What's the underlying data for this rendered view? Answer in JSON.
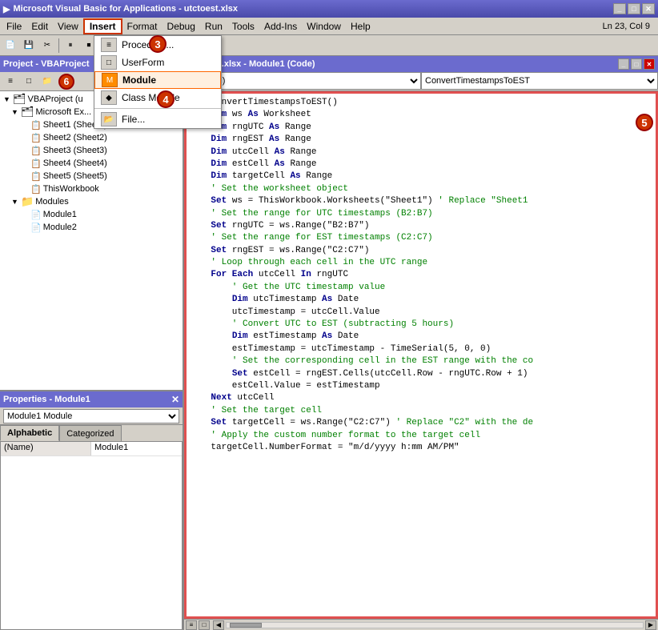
{
  "titlebar": {
    "title": "Microsoft Visual Basic for Applications - utctoest.xlsx",
    "icon": "▶"
  },
  "menubar": {
    "items": [
      {
        "label": "File",
        "id": "file"
      },
      {
        "label": "Edit",
        "id": "edit"
      },
      {
        "label": "View",
        "id": "view"
      },
      {
        "label": "Insert",
        "id": "insert",
        "active": true
      },
      {
        "label": "3",
        "id": "badge3",
        "badge": true
      },
      {
        "label": "Format",
        "id": "format"
      },
      {
        "label": "Debug",
        "id": "debug"
      },
      {
        "label": "Run",
        "id": "run"
      },
      {
        "label": "Tools",
        "id": "tools"
      },
      {
        "label": "Add-Ins",
        "id": "addins"
      },
      {
        "label": "Window",
        "id": "window"
      },
      {
        "label": "Help",
        "id": "help"
      }
    ]
  },
  "toolbar": {
    "status": "Ln 23, Col 9"
  },
  "dropdown": {
    "items": [
      {
        "label": "Procedure...",
        "id": "procedure",
        "icon": "≡"
      },
      {
        "label": "UserForm",
        "id": "userform",
        "icon": "□"
      },
      {
        "label": "Module",
        "id": "module",
        "icon": "📄",
        "highlighted": true
      },
      {
        "label": "Class Module",
        "id": "classmodule",
        "icon": "◆"
      },
      {
        "label": "File...",
        "id": "file",
        "icon": "📂"
      }
    ]
  },
  "project_panel": {
    "title": "Project - VBAProject",
    "tree": [
      {
        "label": "VBAProject (u",
        "level": 0,
        "expanded": true,
        "icon": "📁"
      },
      {
        "label": "Microsoft Ex...",
        "level": 1,
        "expanded": true,
        "icon": "📁"
      },
      {
        "label": "Sheet1 (Sheet1)",
        "level": 2,
        "expanded": false,
        "icon": "📄"
      },
      {
        "label": "Sheet2 (Sheet2)",
        "level": 2,
        "expanded": false,
        "icon": "📄"
      },
      {
        "label": "Sheet3 (Sheet3)",
        "level": 2,
        "expanded": false,
        "icon": "📄"
      },
      {
        "label": "Sheet4 (Sheet4)",
        "level": 2,
        "expanded": false,
        "icon": "📄"
      },
      {
        "label": "Sheet5 (Sheet5)",
        "level": 2,
        "expanded": false,
        "icon": "📄"
      },
      {
        "label": "ThisWorkbook",
        "level": 2,
        "expanded": false,
        "icon": "📄"
      },
      {
        "label": "Modules",
        "level": 1,
        "expanded": true,
        "icon": "📁"
      },
      {
        "label": "Module1",
        "level": 2,
        "expanded": false,
        "icon": "📄"
      },
      {
        "label": "Module2",
        "level": 2,
        "expanded": false,
        "icon": "📄"
      }
    ]
  },
  "properties_panel": {
    "title": "Properties - Module1",
    "dropdown_value": "Module1  Module",
    "tabs": [
      "Alphabetic",
      "Categorized"
    ],
    "active_tab": "Alphabetic",
    "rows": [
      {
        "name": "(Name)",
        "value": "Module1"
      }
    ]
  },
  "code_window": {
    "title": "utctoest.xlsx - Module1 (Code)",
    "selector_left": "(General)",
    "selector_right": "ConvertTimestampsToEST",
    "code_lines": [
      {
        "text": "Sub ConvertTimestampsToEST()",
        "tokens": [
          {
            "type": "kw",
            "text": "Sub"
          },
          {
            "type": "id",
            "text": " ConvertTimestampsToEST()"
          }
        ]
      },
      {
        "text": "    Dim ws As Worksheet",
        "tokens": [
          {
            "type": "id",
            "text": "    "
          },
          {
            "type": "kw",
            "text": "Dim"
          },
          {
            "type": "id",
            "text": " ws "
          },
          {
            "type": "kw",
            "text": "As"
          },
          {
            "type": "id",
            "text": " Worksheet"
          }
        ]
      },
      {
        "text": "    Dim rngUTC As Range",
        "tokens": [
          {
            "type": "id",
            "text": "    "
          },
          {
            "type": "kw",
            "text": "Dim"
          },
          {
            "type": "id",
            "text": " rngUTC "
          },
          {
            "type": "kw",
            "text": "As"
          },
          {
            "type": "id",
            "text": " Range"
          }
        ]
      },
      {
        "text": "    Dim rngEST As Range",
        "tokens": [
          {
            "type": "id",
            "text": "    "
          },
          {
            "type": "kw",
            "text": "Dim"
          },
          {
            "type": "id",
            "text": " rngEST "
          },
          {
            "type": "kw",
            "text": "As"
          },
          {
            "type": "id",
            "text": " Range"
          }
        ]
      },
      {
        "text": "    Dim utcCell As Range",
        "tokens": [
          {
            "type": "id",
            "text": "    "
          },
          {
            "type": "kw",
            "text": "Dim"
          },
          {
            "type": "id",
            "text": " utcCell "
          },
          {
            "type": "kw",
            "text": "As"
          },
          {
            "type": "id",
            "text": " Range"
          }
        ]
      },
      {
        "text": "    Dim estCell As Range",
        "tokens": [
          {
            "type": "id",
            "text": "    "
          },
          {
            "type": "kw",
            "text": "Dim"
          },
          {
            "type": "id",
            "text": " estCell "
          },
          {
            "type": "kw",
            "text": "As"
          },
          {
            "type": "id",
            "text": " Range"
          }
        ]
      },
      {
        "text": "    Dim targetCell As Range",
        "tokens": [
          {
            "type": "id",
            "text": "    "
          },
          {
            "type": "kw",
            "text": "Dim"
          },
          {
            "type": "id",
            "text": " targetCell "
          },
          {
            "type": "kw",
            "text": "As"
          },
          {
            "type": "id",
            "text": " Range"
          }
        ]
      },
      {
        "text": "",
        "tokens": []
      },
      {
        "text": "    ' Set the worksheet object",
        "tokens": [
          {
            "type": "cm",
            "text": "    ' Set the worksheet object"
          }
        ]
      },
      {
        "text": "    Set ws = ThisWorkbook.Worksheets(\"Sheet1\") ' Replace \"Sheet1",
        "tokens": [
          {
            "type": "id",
            "text": "    "
          },
          {
            "type": "kw",
            "text": "Set"
          },
          {
            "type": "id",
            "text": " ws = ThisWorkbook.Worksheets(\"Sheet1\")"
          },
          {
            "type": "cm",
            "text": " ' Replace \"Sheet1"
          }
        ]
      },
      {
        "text": "",
        "tokens": []
      },
      {
        "text": "    ' Set the range for UTC timestamps (B2:B7)",
        "tokens": [
          {
            "type": "cm",
            "text": "    ' Set the range for UTC timestamps (B2:B7)"
          }
        ]
      },
      {
        "text": "    Set rngUTC = ws.Range(\"B2:B7\")",
        "tokens": [
          {
            "type": "id",
            "text": "    "
          },
          {
            "type": "kw",
            "text": "Set"
          },
          {
            "type": "id",
            "text": " rngUTC = ws.Range(\"B2:B7\")"
          }
        ]
      },
      {
        "text": "",
        "tokens": []
      },
      {
        "text": "    ' Set the range for EST timestamps (C2:C7)",
        "tokens": [
          {
            "type": "cm",
            "text": "    ' Set the range for EST timestamps (C2:C7)"
          }
        ]
      },
      {
        "text": "    Set rngEST = ws.Range(\"C2:C7\")",
        "tokens": [
          {
            "type": "id",
            "text": "    "
          },
          {
            "type": "kw",
            "text": "Set"
          },
          {
            "type": "id",
            "text": " rngEST = ws.Range(\"C2:C7\")"
          }
        ]
      },
      {
        "text": "",
        "tokens": []
      },
      {
        "text": "    ' Loop through each cell in the UTC range",
        "tokens": [
          {
            "type": "cm",
            "text": "    ' Loop through each cell in the UTC range"
          }
        ]
      },
      {
        "text": "    For Each utcCell In rngUTC",
        "tokens": [
          {
            "type": "id",
            "text": "    "
          },
          {
            "type": "kw",
            "text": "For Each"
          },
          {
            "type": "id",
            "text": " utcCell "
          },
          {
            "type": "kw",
            "text": "In"
          },
          {
            "type": "id",
            "text": " rngUTC"
          }
        ]
      },
      {
        "text": "        ' Get the UTC timestamp value",
        "tokens": [
          {
            "type": "cm",
            "text": "        ' Get the UTC timestamp value"
          }
        ]
      },
      {
        "text": "        Dim utcTimestamp As Date",
        "tokens": [
          {
            "type": "id",
            "text": "        "
          },
          {
            "type": "kw",
            "text": "Dim"
          },
          {
            "type": "id",
            "text": " utcTimestamp "
          },
          {
            "type": "kw",
            "text": "As"
          },
          {
            "type": "id",
            "text": " Date"
          }
        ]
      },
      {
        "text": "        utcTimestamp = utcCell.Value",
        "tokens": [
          {
            "type": "id",
            "text": "        utcTimestamp = utcCell.Value"
          }
        ]
      },
      {
        "text": "",
        "tokens": []
      },
      {
        "text": "        ' Convert UTC to EST (subtracting 5 hours)",
        "tokens": [
          {
            "type": "cm",
            "text": "        ' Convert UTC to EST (subtracting 5 hours)"
          }
        ]
      },
      {
        "text": "        Dim estTimestamp As Date",
        "tokens": [
          {
            "type": "id",
            "text": "        "
          },
          {
            "type": "kw",
            "text": "Dim"
          },
          {
            "type": "id",
            "text": " estTimestamp "
          },
          {
            "type": "kw",
            "text": "As"
          },
          {
            "type": "id",
            "text": " Date"
          }
        ]
      },
      {
        "text": "        estTimestamp = utcTimestamp - TimeSerial(5, 0, 0)",
        "tokens": [
          {
            "type": "id",
            "text": "        estTimestamp = utcTimestamp - TimeSerial(5, 0, 0)"
          }
        ]
      },
      {
        "text": "",
        "tokens": []
      },
      {
        "text": "        ' Set the corresponding cell in the EST range with the co",
        "tokens": [
          {
            "type": "cm",
            "text": "        ' Set the corresponding cell in the EST range with the co"
          }
        ]
      },
      {
        "text": "        Set estCell = rngEST.Cells(utcCell.Row - rngUTC.Row + 1)",
        "tokens": [
          {
            "type": "id",
            "text": "        "
          },
          {
            "type": "kw",
            "text": "Set"
          },
          {
            "type": "id",
            "text": " estCell = rngEST.Cells(utcCell.Row - rngUTC.Row + 1)"
          }
        ]
      },
      {
        "text": "        estCell.Value = estTimestamp",
        "tokens": [
          {
            "type": "id",
            "text": "        estCell.Value = estTimestamp"
          }
        ]
      },
      {
        "text": "    Next utcCell",
        "tokens": [
          {
            "type": "id",
            "text": "    "
          },
          {
            "type": "kw",
            "text": "Next"
          },
          {
            "type": "id",
            "text": " utcCell"
          }
        ]
      },
      {
        "text": "",
        "tokens": []
      },
      {
        "text": "    ' Set the target cell",
        "tokens": [
          {
            "type": "cm",
            "text": "    ' Set the target cell"
          }
        ]
      },
      {
        "text": "    Set targetCell = ws.Range(\"C2:C7\") ' Replace \"C2\" with the de",
        "tokens": [
          {
            "type": "id",
            "text": "    "
          },
          {
            "type": "kw",
            "text": "Set"
          },
          {
            "type": "id",
            "text": " targetCell = ws.Range(\"C2:C7\")"
          },
          {
            "type": "cm",
            "text": " ' Replace \"C2\" with the de"
          }
        ]
      },
      {
        "text": "",
        "tokens": []
      },
      {
        "text": "    ' Apply the custom number format to the target cell",
        "tokens": [
          {
            "type": "cm",
            "text": "    ' Apply the custom number format to the target cell"
          }
        ]
      },
      {
        "text": "    targetCell.NumberFormat = \"m/d/yyyy h:mm AM/PM\"",
        "tokens": [
          {
            "type": "id",
            "text": "    targetCell.NumberFormat = \"m/d/yyyy h:mm AM/PM\""
          }
        ]
      }
    ]
  },
  "badges": {
    "b3": "3",
    "b4": "4",
    "b5": "5",
    "b6": "6"
  }
}
